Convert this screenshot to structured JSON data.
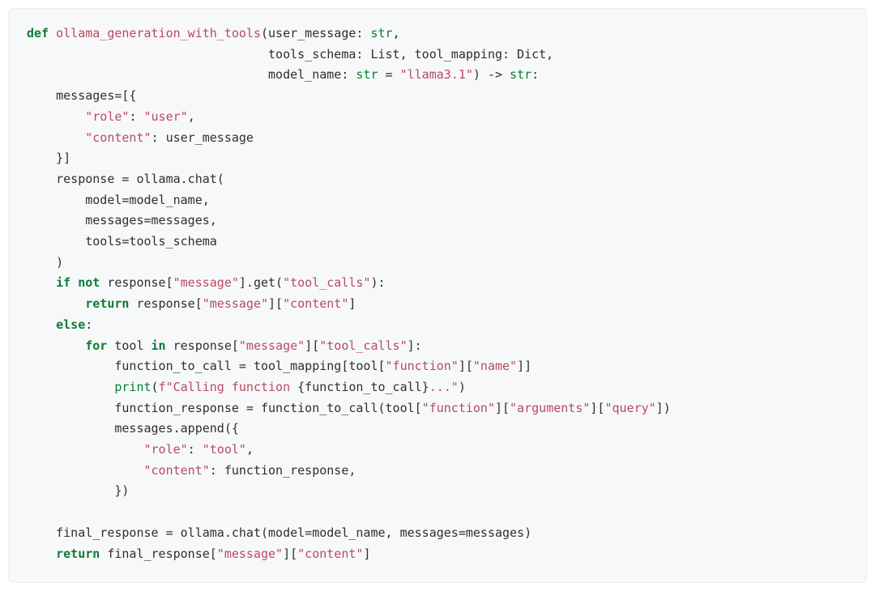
{
  "code": {
    "lines": [
      {
        "segs": [
          {
            "t": "def ",
            "c": "kw"
          },
          {
            "t": "ollama_generation_with_tools",
            "c": "fn"
          },
          {
            "t": "(user_message: "
          },
          {
            "t": "str",
            "c": "bi"
          },
          {
            "t": ","
          }
        ]
      },
      {
        "segs": [
          {
            "t": "                                 tools_schema: List, tool_mapping: Dict,"
          }
        ]
      },
      {
        "segs": [
          {
            "t": "                                 model_name: "
          },
          {
            "t": "str",
            "c": "bi"
          },
          {
            "t": " = "
          },
          {
            "t": "\"llama3.1\"",
            "c": "str"
          },
          {
            "t": ") -> "
          },
          {
            "t": "str",
            "c": "bi"
          },
          {
            "t": ":"
          }
        ]
      },
      {
        "segs": [
          {
            "t": "    messages=[{"
          }
        ]
      },
      {
        "segs": [
          {
            "t": "        "
          },
          {
            "t": "\"role\"",
            "c": "str"
          },
          {
            "t": ": "
          },
          {
            "t": "\"user\"",
            "c": "str"
          },
          {
            "t": ","
          }
        ]
      },
      {
        "segs": [
          {
            "t": "        "
          },
          {
            "t": "\"content\"",
            "c": "str"
          },
          {
            "t": ": user_message"
          }
        ]
      },
      {
        "segs": [
          {
            "t": "    }]"
          }
        ]
      },
      {
        "segs": [
          {
            "t": "    response = ollama.chat("
          }
        ]
      },
      {
        "segs": [
          {
            "t": "        model=model_name,"
          }
        ]
      },
      {
        "segs": [
          {
            "t": "        messages=messages,"
          }
        ]
      },
      {
        "segs": [
          {
            "t": "        tools=tools_schema"
          }
        ]
      },
      {
        "segs": [
          {
            "t": "    )"
          }
        ]
      },
      {
        "segs": [
          {
            "t": "    "
          },
          {
            "t": "if not",
            "c": "kw"
          },
          {
            "t": " response["
          },
          {
            "t": "\"message\"",
            "c": "str"
          },
          {
            "t": "].get("
          },
          {
            "t": "\"tool_calls\"",
            "c": "str"
          },
          {
            "t": "):"
          }
        ]
      },
      {
        "segs": [
          {
            "t": "        "
          },
          {
            "t": "return",
            "c": "kw"
          },
          {
            "t": " response["
          },
          {
            "t": "\"message\"",
            "c": "str"
          },
          {
            "t": "]["
          },
          {
            "t": "\"content\"",
            "c": "str"
          },
          {
            "t": "]"
          }
        ]
      },
      {
        "segs": [
          {
            "t": "    "
          },
          {
            "t": "else",
            "c": "kw"
          },
          {
            "t": ":"
          }
        ]
      },
      {
        "segs": [
          {
            "t": "        "
          },
          {
            "t": "for",
            "c": "kw"
          },
          {
            "t": " tool "
          },
          {
            "t": "in",
            "c": "kw"
          },
          {
            "t": " response["
          },
          {
            "t": "\"message\"",
            "c": "str"
          },
          {
            "t": "]["
          },
          {
            "t": "\"tool_calls\"",
            "c": "str"
          },
          {
            "t": "]:"
          }
        ]
      },
      {
        "segs": [
          {
            "t": "            function_to_call = tool_mapping[tool["
          },
          {
            "t": "\"function\"",
            "c": "str"
          },
          {
            "t": "]["
          },
          {
            "t": "\"name\"",
            "c": "str"
          },
          {
            "t": "]]"
          }
        ]
      },
      {
        "segs": [
          {
            "t": "            "
          },
          {
            "t": "print",
            "c": "bi"
          },
          {
            "t": "("
          },
          {
            "t": "f\"Calling function ",
            "c": "str"
          },
          {
            "t": "{function_to_call}"
          },
          {
            "t": "...\"",
            "c": "str"
          },
          {
            "t": ")"
          }
        ]
      },
      {
        "segs": [
          {
            "t": "            function_response = function_to_call(tool["
          },
          {
            "t": "\"function\"",
            "c": "str"
          },
          {
            "t": "]["
          },
          {
            "t": "\"arguments\"",
            "c": "str"
          },
          {
            "t": "]["
          },
          {
            "t": "\"query\"",
            "c": "str"
          },
          {
            "t": "])"
          }
        ]
      },
      {
        "segs": [
          {
            "t": "            messages.append({"
          }
        ]
      },
      {
        "segs": [
          {
            "t": "                "
          },
          {
            "t": "\"role\"",
            "c": "str"
          },
          {
            "t": ": "
          },
          {
            "t": "\"tool\"",
            "c": "str"
          },
          {
            "t": ","
          }
        ]
      },
      {
        "segs": [
          {
            "t": "                "
          },
          {
            "t": "\"content\"",
            "c": "str"
          },
          {
            "t": ": function_response,"
          }
        ]
      },
      {
        "segs": [
          {
            "t": "            })"
          }
        ]
      },
      {
        "segs": [
          {
            "t": ""
          }
        ]
      },
      {
        "segs": [
          {
            "t": "    final_response = ollama.chat(model=model_name, messages=messages)"
          }
        ]
      },
      {
        "segs": [
          {
            "t": "    "
          },
          {
            "t": "return",
            "c": "kw"
          },
          {
            "t": " final_response["
          },
          {
            "t": "\"message\"",
            "c": "str"
          },
          {
            "t": "]["
          },
          {
            "t": "\"content\"",
            "c": "str"
          },
          {
            "t": "]"
          }
        ]
      }
    ]
  }
}
